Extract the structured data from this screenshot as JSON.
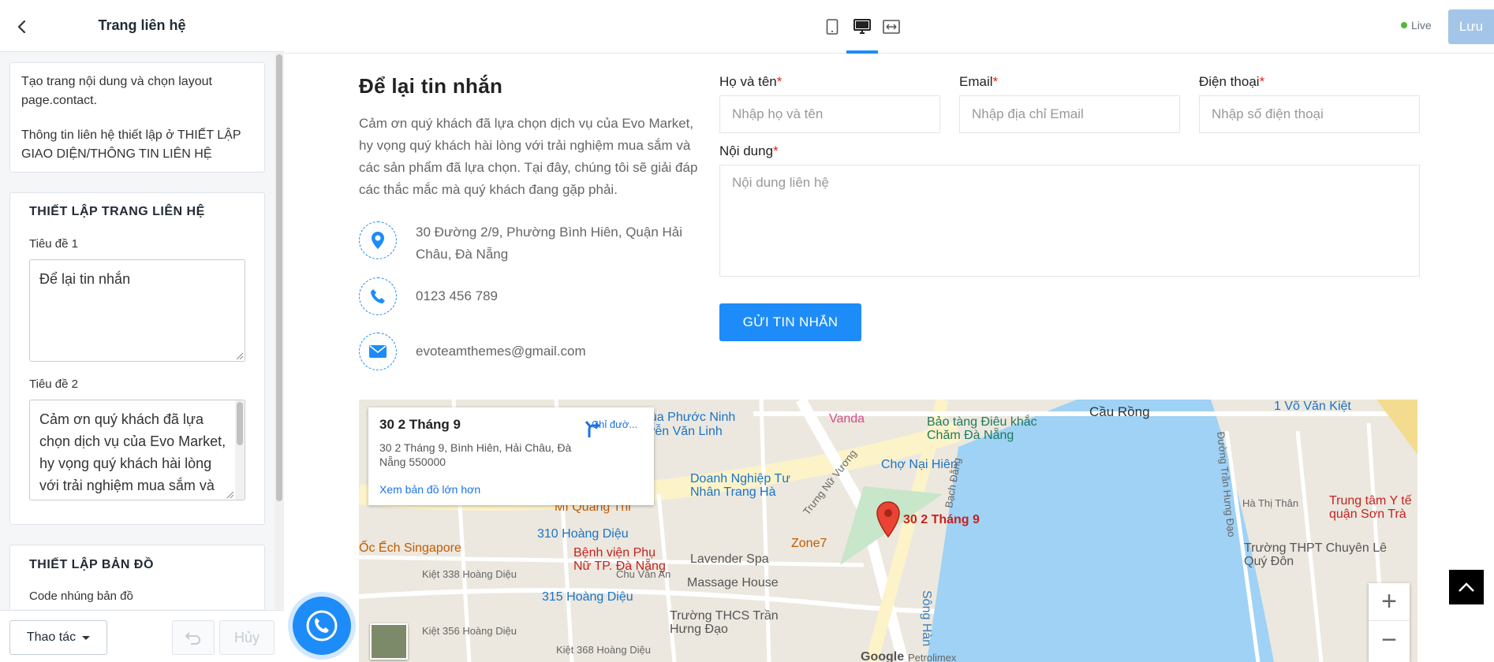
{
  "sidebar": {
    "title": "Trang liên hệ",
    "note": {
      "line1": "Tạo trang nội dung và chọn layout page.contact.",
      "line2": "Thông tin liên hệ thiết lập ở THIẾT LẬP GIAO DIỆN/THÔNG TIN LIÊN HỆ"
    },
    "contact_settings": {
      "heading": "THIẾT LẬP TRANG LIÊN HỆ",
      "title1_label": "Tiêu đề 1",
      "title1_value": "Để lại tin nhắn",
      "title2_label": "Tiêu đề 2",
      "title2_value": "Cảm ơn quý khách đã lựa chọn dịch vụ của Evo Market, hy vọng quý khách hài lòng với trải nghiệm mua sắm và các sản phẩm đã lựa chọn."
    },
    "map_settings": {
      "heading": "THIẾT LẬP BẢN ĐỒ",
      "embed_label": "Code nhúng bản đồ"
    },
    "footer": {
      "actions_label": "Thao tác",
      "cancel_label": "Hủy"
    }
  },
  "topbar": {
    "devices": [
      "mobile",
      "desktop",
      "full-width"
    ],
    "active_device": "desktop",
    "live_label": "Live",
    "save_label": "Lưu"
  },
  "preview": {
    "title": "Để lại tin nhắn",
    "description": "Cảm ơn quý khách đã lựa chọn dịch vụ của Evo Market, hy vọng quý khách hài lòng với trải nghiệm mua sắm và các sản phẩm đã lựa chọn. Tại đây, chúng tôi sẽ giải đáp các thắc mắc mà quý khách đang gặp phải.",
    "contact": {
      "address": "30 Đường 2/9, Phường Bình Hiên, Quận Hải Châu, Đà Nẵng",
      "phone": "0123 456 789",
      "email": "evoteamthemes@gmail.com"
    },
    "form": {
      "name_label": "Họ và tên",
      "name_placeholder": "Nhập họ và tên",
      "email_label": "Email",
      "email_placeholder": "Nhập địa chỉ Email",
      "phone_label": "Điện thoại",
      "phone_placeholder": "Nhập số điện thoại",
      "message_label": "Nội dung",
      "message_placeholder": "Nội dung liên hệ",
      "required_mark": "*",
      "submit_label": "GỬI TIN NHẮN"
    },
    "map": {
      "card_title": "30 2 Tháng 9",
      "card_address": "30 2 Tháng 9, Bình Hiên, Hải Châu, Đà Nẵng 550000",
      "card_link": "Xem bản đồ lớn hơn",
      "directions_label": "Chỉ đườ...",
      "pin_label": "30 2 Tháng 9",
      "labels": {
        "pagoda": "chùa Phước Ninh",
        "nvl": "Nguyễn Văn Linh",
        "vanda": "Vanda",
        "museum": "Bảo tàng Điêu khắc Chăm Đà Nẵng",
        "cau_rong": "Cầu Rồng",
        "vo_van_kiet": "1 Võ Văn Kiệt",
        "cho": "Chợ Nại Hiên",
        "doanh_nghiep": "Doanh Nghiệp Tư Nhân Trang Hà",
        "mi_quang": "Mì Quảng Thi",
        "hoang_dieu_310": "310 Hoàng Diệu",
        "oc": "Ốc Ếch Singapore",
        "benh_vien": "Bệnh viện Phụ Nữ TP. Đà Nẵng",
        "lavender": "Lavender Spa",
        "zone7": "Zone7",
        "massage": "Massage House",
        "hoang_dieu_315": "315 Hoàng Diệu",
        "thcs": "Trường THCS Trần Hưng Đạo",
        "song_han": "Sông Hàn",
        "thpt": "Trường THPT Chuyên Lê Quý Đôn",
        "trung_tam": "Trung tâm Y tế quận Sơn Trà",
        "tran_hung_dao": "Đường Trần Hưng Đạo",
        "ha_thi_than": "Hà Thị Thân",
        "bach_dang": "Bạch Đằng",
        "trung_nu_vuong": "Trưng Nữ Vương",
        "chu_van_an": "Chu Văn An",
        "kiet_338": "Kiệt 338 Hoàng Diệu",
        "kiet_356": "Kiệt 356 Hoàng Diệu",
        "kiet_368": "Kiệt 368 Hoàng Diệu",
        "google": "Google",
        "petrolimex": "Petrolimex"
      }
    }
  },
  "colors": {
    "accent": "#1d8cf8",
    "required": "#e02424",
    "live_dot": "#50b83c",
    "save_disabled": "#a3c5e8",
    "water": "#9fd2f5"
  }
}
